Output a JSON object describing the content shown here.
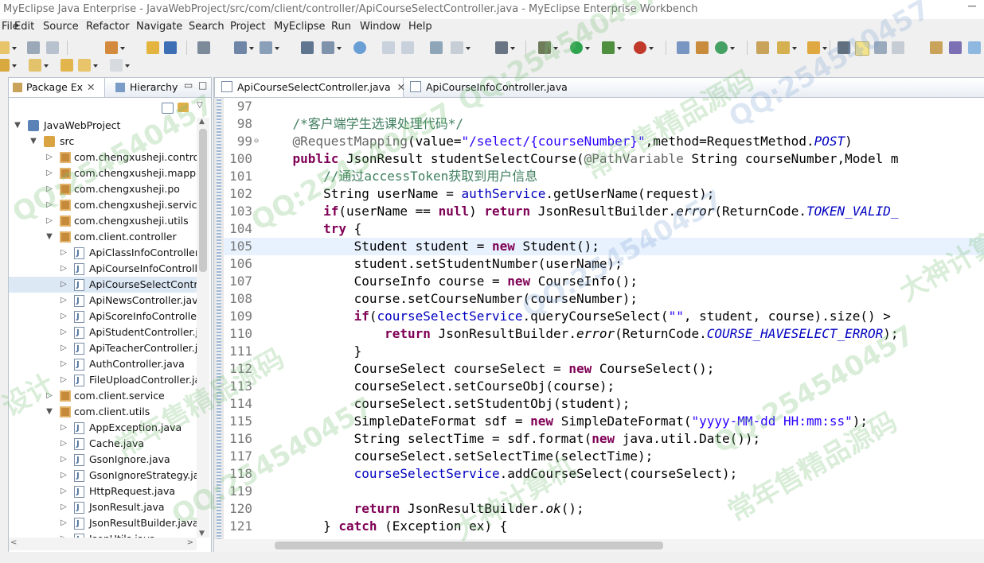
{
  "window": {
    "title": "MyEclipse Java Enterprise - JavaWebProject/src/com/client/controller/ApiCourseSelectController.java - MyEclipse Enterprise Workbench"
  },
  "menubar": [
    "File",
    "Edit",
    "Source",
    "Refactor",
    "Navigate",
    "Search",
    "Project",
    "MyEclipse",
    "Run",
    "Window",
    "Help"
  ],
  "package_explorer": {
    "tabs": [
      "Package Ex",
      "Hierarchy"
    ],
    "tree": [
      {
        "label": "JavaWebProject",
        "icon": "project-icon",
        "expanded": true
      },
      {
        "label": "src",
        "icon": "source-folder-icon",
        "expanded": true
      },
      {
        "label": "com.chengxusheji.controller",
        "icon": "package-icon"
      },
      {
        "label": "com.chengxusheji.mapper",
        "icon": "package-icon"
      },
      {
        "label": "com.chengxusheji.po",
        "icon": "package-icon"
      },
      {
        "label": "com.chengxusheji.service",
        "icon": "package-icon"
      },
      {
        "label": "com.chengxusheji.utils",
        "icon": "package-icon"
      },
      {
        "label": "com.client.controller",
        "icon": "package-icon",
        "expanded": true
      },
      {
        "label": "ApiClassInfoController.java",
        "icon": "java-file-icon"
      },
      {
        "label": "ApiCourseInfoController.java",
        "icon": "java-file-icon"
      },
      {
        "label": "ApiCourseSelectController.java",
        "icon": "java-file-icon",
        "selected": true
      },
      {
        "label": "ApiNewsController.java",
        "icon": "java-file-icon"
      },
      {
        "label": "ApiScoreInfoController.java",
        "icon": "java-file-icon"
      },
      {
        "label": "ApiStudentController.java",
        "icon": "java-file-icon"
      },
      {
        "label": "ApiTeacherController.java",
        "icon": "java-file-icon"
      },
      {
        "label": "AuthController.java",
        "icon": "java-file-icon"
      },
      {
        "label": "FileUploadController.java",
        "icon": "java-file-icon"
      },
      {
        "label": "com.client.service",
        "icon": "package-icon"
      },
      {
        "label": "com.client.utils",
        "icon": "package-icon",
        "expanded": true
      },
      {
        "label": "AppException.java",
        "icon": "java-file-icon"
      },
      {
        "label": "Cache.java",
        "icon": "java-file-icon"
      },
      {
        "label": "GsonIgnore.java",
        "icon": "java-file-icon"
      },
      {
        "label": "GsonIgnoreStrategy.java",
        "icon": "java-file-icon"
      },
      {
        "label": "HttpRequest.java",
        "icon": "java-file-icon"
      },
      {
        "label": "JsonResult.java",
        "icon": "java-file-icon"
      },
      {
        "label": "JsonResultBuilder.java",
        "icon": "java-file-icon"
      },
      {
        "label": "JsonUtils.java",
        "icon": "java-file-icon"
      }
    ]
  },
  "editor": {
    "tabs": [
      "ApiCourseSelectController.java",
      "ApiCourseInfoController.java"
    ],
    "line_numbers": [
      "97",
      "98",
      "99",
      "100",
      "101",
      "102",
      "103",
      "104",
      "105",
      "106",
      "107",
      "108",
      "109",
      "110",
      "111",
      "112",
      "113",
      "114",
      "115",
      "116",
      "117",
      "118",
      "119",
      "120",
      "121"
    ],
    "lines": [
      "",
      "    /*客户端学生选课处理代码*/",
      "    @RequestMapping(value=\"/select/{courseNumber}\",method=RequestMethod.POST)",
      "    public JsonResult studentSelectCourse(@PathVariable String courseNumber,Model m",
      "        //通过accessToken获取到用户信息",
      "        String userName = authService.getUserName(request);",
      "        if(userName == null) return JsonResultBuilder.error(ReturnCode.TOKEN_VALID_",
      "        try {",
      "            Student student = new Student();",
      "            student.setStudentNumber(userName);",
      "            CourseInfo course = new CourseInfo();",
      "            course.setCourseNumber(courseNumber);",
      "            if(courseSelectService.queryCourseSelect(\"\", student, course).size() >",
      "                return JsonResultBuilder.error(ReturnCode.COURSE_HAVESELECT_ERROR);",
      "            }",
      "            CourseSelect courseSelect = new CourseSelect();",
      "            courseSelect.setCourseObj(course);",
      "            courseSelect.setStudentObj(student);",
      "            SimpleDateFormat sdf = new SimpleDateFormat(\"yyyy-MM-dd HH:mm:ss\");",
      "            String selectTime = sdf.format(new java.util.Date());",
      "            courseSelect.setSelectTime(selectTime);",
      "            courseSelectService.addCourseSelect(courseSelect);",
      "",
      "            return JsonResultBuilder.ok();",
      "        } catch (Exception ex) {"
    ],
    "current_line": "105"
  },
  "watermarks": [
    "QQ:254540457",
    "大神计算机",
    "常年售精品源码",
    "设计"
  ],
  "colors": {
    "keyword": "#7f0055",
    "comment": "#3f7f5f",
    "string": "#2a00ff",
    "field": "#0000c0",
    "annotation": "#646464",
    "current_line_bg": "#e8f2fe",
    "selection_bg": "#dde8f5"
  }
}
